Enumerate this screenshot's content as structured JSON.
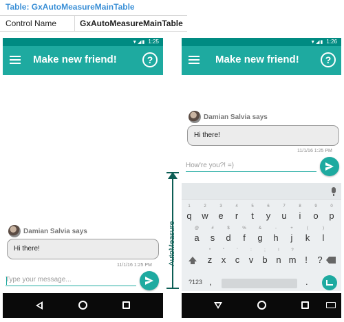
{
  "table": {
    "title": "Table: GxAutoMeasureMainTable",
    "property_label": "Control Name",
    "property_value": "GxAutoMeasureMainTable"
  },
  "colors": {
    "app_bar": "#1eaaa0",
    "status_bar": "#008b82",
    "accent": "#1eaaa0",
    "measure": "#0d5e55",
    "table_title": "#3a8fd6"
  },
  "left_phone": {
    "status_time": "1:25",
    "app_title": "Make new friend!",
    "sender": "Damian Salvia says",
    "message": "Hi there!",
    "timestamp": "11/1/16 1:25 PM",
    "input_placeholder": "Type your message..."
  },
  "right_phone": {
    "status_time": "1:26",
    "app_title": "Make new friend!",
    "sender": "Damian Salvia says",
    "message": "Hi there!",
    "timestamp": "11/1/16 1:25 PM",
    "input_value": "How're you?! =)"
  },
  "keyboard": {
    "row1": [
      "q",
      "w",
      "e",
      "r",
      "t",
      "y",
      "u",
      "i",
      "o",
      "p"
    ],
    "row1_hints": [
      "1",
      "2",
      "3",
      "4",
      "5",
      "6",
      "7",
      "8",
      "9",
      "0"
    ],
    "row2": [
      "a",
      "s",
      "d",
      "f",
      "g",
      "h",
      "j",
      "k",
      "l"
    ],
    "row2_hints": [
      "@",
      "#",
      "$",
      "%",
      "&",
      "-",
      "+",
      "(",
      ")"
    ],
    "row3": [
      "z",
      "x",
      "c",
      "v",
      "b",
      "n",
      "m",
      "!",
      "?"
    ],
    "row3_hints": [
      "*",
      "\"",
      "'",
      ":",
      ";",
      "!",
      "?",
      "",
      ""
    ],
    "symbols_key": "?123",
    "comma_key": ",",
    "period_key": "."
  },
  "annotation": {
    "label": "AutoMeasure"
  },
  "icons": {
    "menu": "menu-icon",
    "help": "help-circle-icon",
    "send": "send-icon",
    "back": "nav-back-icon",
    "home": "nav-home-icon",
    "recents": "nav-recents-icon",
    "mic": "mic-icon",
    "shift": "shift-icon",
    "backspace": "backspace-icon",
    "enter": "enter-icon",
    "emoji": "emoji-icon"
  }
}
